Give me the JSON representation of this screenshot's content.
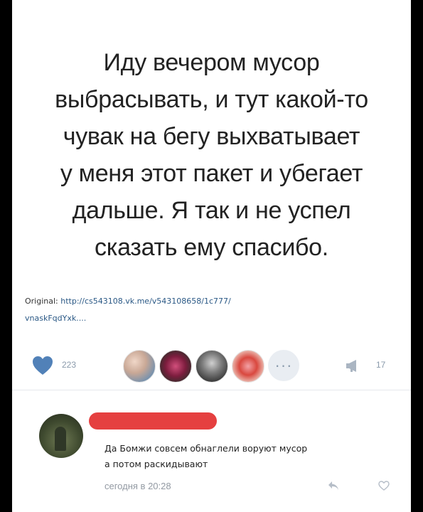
{
  "post": {
    "quote_lines": [
      "Иду вечером мусор",
      "выбрасывать, и тут какой-то",
      "чувак на бегу выхватывает",
      "у меня этот пакет и убегает",
      "дальше. Я так и не успел",
      "сказать ему спасибо."
    ],
    "original_label": "Original:",
    "original_link_line1": "http://cs543108.vk.me/v543108658/1c777/",
    "original_link_line2": "vnaskFqdYxk...."
  },
  "actions": {
    "like_icon": "heart-icon",
    "like_count": "223",
    "more_label": "···",
    "views_icon": "megaphone-icon",
    "views_count": "17",
    "accent_color": "#5181b8"
  },
  "comment": {
    "text_line1": "Да Бомжи совсем обнаглели воруют мусор",
    "text_line2": "а потом раскидывают",
    "time": "сегодня в 20:28",
    "redaction_color": "#e54040"
  }
}
